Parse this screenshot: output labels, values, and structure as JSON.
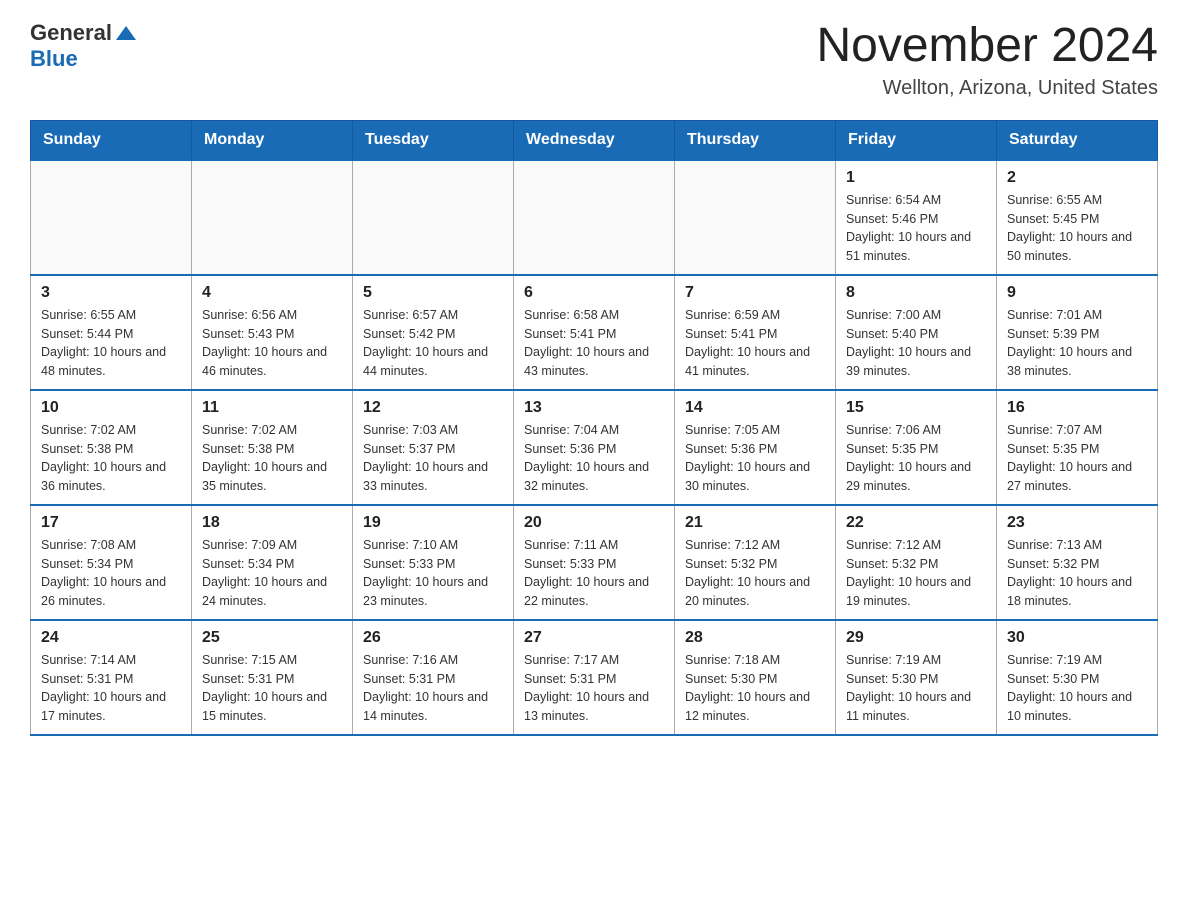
{
  "header": {
    "logo": {
      "general": "General",
      "blue": "Blue"
    },
    "title": "November 2024",
    "location": "Wellton, Arizona, United States"
  },
  "calendar": {
    "days_of_week": [
      "Sunday",
      "Monday",
      "Tuesday",
      "Wednesday",
      "Thursday",
      "Friday",
      "Saturday"
    ],
    "weeks": [
      [
        {
          "day": "",
          "sunrise": "",
          "sunset": "",
          "daylight": "",
          "empty": true
        },
        {
          "day": "",
          "sunrise": "",
          "sunset": "",
          "daylight": "",
          "empty": true
        },
        {
          "day": "",
          "sunrise": "",
          "sunset": "",
          "daylight": "",
          "empty": true
        },
        {
          "day": "",
          "sunrise": "",
          "sunset": "",
          "daylight": "",
          "empty": true
        },
        {
          "day": "",
          "sunrise": "",
          "sunset": "",
          "daylight": "",
          "empty": true
        },
        {
          "day": "1",
          "sunrise": "Sunrise: 6:54 AM",
          "sunset": "Sunset: 5:46 PM",
          "daylight": "Daylight: 10 hours and 51 minutes.",
          "empty": false
        },
        {
          "day": "2",
          "sunrise": "Sunrise: 6:55 AM",
          "sunset": "Sunset: 5:45 PM",
          "daylight": "Daylight: 10 hours and 50 minutes.",
          "empty": false
        }
      ],
      [
        {
          "day": "3",
          "sunrise": "Sunrise: 6:55 AM",
          "sunset": "Sunset: 5:44 PM",
          "daylight": "Daylight: 10 hours and 48 minutes.",
          "empty": false
        },
        {
          "day": "4",
          "sunrise": "Sunrise: 6:56 AM",
          "sunset": "Sunset: 5:43 PM",
          "daylight": "Daylight: 10 hours and 46 minutes.",
          "empty": false
        },
        {
          "day": "5",
          "sunrise": "Sunrise: 6:57 AM",
          "sunset": "Sunset: 5:42 PM",
          "daylight": "Daylight: 10 hours and 44 minutes.",
          "empty": false
        },
        {
          "day": "6",
          "sunrise": "Sunrise: 6:58 AM",
          "sunset": "Sunset: 5:41 PM",
          "daylight": "Daylight: 10 hours and 43 minutes.",
          "empty": false
        },
        {
          "day": "7",
          "sunrise": "Sunrise: 6:59 AM",
          "sunset": "Sunset: 5:41 PM",
          "daylight": "Daylight: 10 hours and 41 minutes.",
          "empty": false
        },
        {
          "day": "8",
          "sunrise": "Sunrise: 7:00 AM",
          "sunset": "Sunset: 5:40 PM",
          "daylight": "Daylight: 10 hours and 39 minutes.",
          "empty": false
        },
        {
          "day": "9",
          "sunrise": "Sunrise: 7:01 AM",
          "sunset": "Sunset: 5:39 PM",
          "daylight": "Daylight: 10 hours and 38 minutes.",
          "empty": false
        }
      ],
      [
        {
          "day": "10",
          "sunrise": "Sunrise: 7:02 AM",
          "sunset": "Sunset: 5:38 PM",
          "daylight": "Daylight: 10 hours and 36 minutes.",
          "empty": false
        },
        {
          "day": "11",
          "sunrise": "Sunrise: 7:02 AM",
          "sunset": "Sunset: 5:38 PM",
          "daylight": "Daylight: 10 hours and 35 minutes.",
          "empty": false
        },
        {
          "day": "12",
          "sunrise": "Sunrise: 7:03 AM",
          "sunset": "Sunset: 5:37 PM",
          "daylight": "Daylight: 10 hours and 33 minutes.",
          "empty": false
        },
        {
          "day": "13",
          "sunrise": "Sunrise: 7:04 AM",
          "sunset": "Sunset: 5:36 PM",
          "daylight": "Daylight: 10 hours and 32 minutes.",
          "empty": false
        },
        {
          "day": "14",
          "sunrise": "Sunrise: 7:05 AM",
          "sunset": "Sunset: 5:36 PM",
          "daylight": "Daylight: 10 hours and 30 minutes.",
          "empty": false
        },
        {
          "day": "15",
          "sunrise": "Sunrise: 7:06 AM",
          "sunset": "Sunset: 5:35 PM",
          "daylight": "Daylight: 10 hours and 29 minutes.",
          "empty": false
        },
        {
          "day": "16",
          "sunrise": "Sunrise: 7:07 AM",
          "sunset": "Sunset: 5:35 PM",
          "daylight": "Daylight: 10 hours and 27 minutes.",
          "empty": false
        }
      ],
      [
        {
          "day": "17",
          "sunrise": "Sunrise: 7:08 AM",
          "sunset": "Sunset: 5:34 PM",
          "daylight": "Daylight: 10 hours and 26 minutes.",
          "empty": false
        },
        {
          "day": "18",
          "sunrise": "Sunrise: 7:09 AM",
          "sunset": "Sunset: 5:34 PM",
          "daylight": "Daylight: 10 hours and 24 minutes.",
          "empty": false
        },
        {
          "day": "19",
          "sunrise": "Sunrise: 7:10 AM",
          "sunset": "Sunset: 5:33 PM",
          "daylight": "Daylight: 10 hours and 23 minutes.",
          "empty": false
        },
        {
          "day": "20",
          "sunrise": "Sunrise: 7:11 AM",
          "sunset": "Sunset: 5:33 PM",
          "daylight": "Daylight: 10 hours and 22 minutes.",
          "empty": false
        },
        {
          "day": "21",
          "sunrise": "Sunrise: 7:12 AM",
          "sunset": "Sunset: 5:32 PM",
          "daylight": "Daylight: 10 hours and 20 minutes.",
          "empty": false
        },
        {
          "day": "22",
          "sunrise": "Sunrise: 7:12 AM",
          "sunset": "Sunset: 5:32 PM",
          "daylight": "Daylight: 10 hours and 19 minutes.",
          "empty": false
        },
        {
          "day": "23",
          "sunrise": "Sunrise: 7:13 AM",
          "sunset": "Sunset: 5:32 PM",
          "daylight": "Daylight: 10 hours and 18 minutes.",
          "empty": false
        }
      ],
      [
        {
          "day": "24",
          "sunrise": "Sunrise: 7:14 AM",
          "sunset": "Sunset: 5:31 PM",
          "daylight": "Daylight: 10 hours and 17 minutes.",
          "empty": false
        },
        {
          "day": "25",
          "sunrise": "Sunrise: 7:15 AM",
          "sunset": "Sunset: 5:31 PM",
          "daylight": "Daylight: 10 hours and 15 minutes.",
          "empty": false
        },
        {
          "day": "26",
          "sunrise": "Sunrise: 7:16 AM",
          "sunset": "Sunset: 5:31 PM",
          "daylight": "Daylight: 10 hours and 14 minutes.",
          "empty": false
        },
        {
          "day": "27",
          "sunrise": "Sunrise: 7:17 AM",
          "sunset": "Sunset: 5:31 PM",
          "daylight": "Daylight: 10 hours and 13 minutes.",
          "empty": false
        },
        {
          "day": "28",
          "sunrise": "Sunrise: 7:18 AM",
          "sunset": "Sunset: 5:30 PM",
          "daylight": "Daylight: 10 hours and 12 minutes.",
          "empty": false
        },
        {
          "day": "29",
          "sunrise": "Sunrise: 7:19 AM",
          "sunset": "Sunset: 5:30 PM",
          "daylight": "Daylight: 10 hours and 11 minutes.",
          "empty": false
        },
        {
          "day": "30",
          "sunrise": "Sunrise: 7:19 AM",
          "sunset": "Sunset: 5:30 PM",
          "daylight": "Daylight: 10 hours and 10 minutes.",
          "empty": false
        }
      ]
    ]
  }
}
